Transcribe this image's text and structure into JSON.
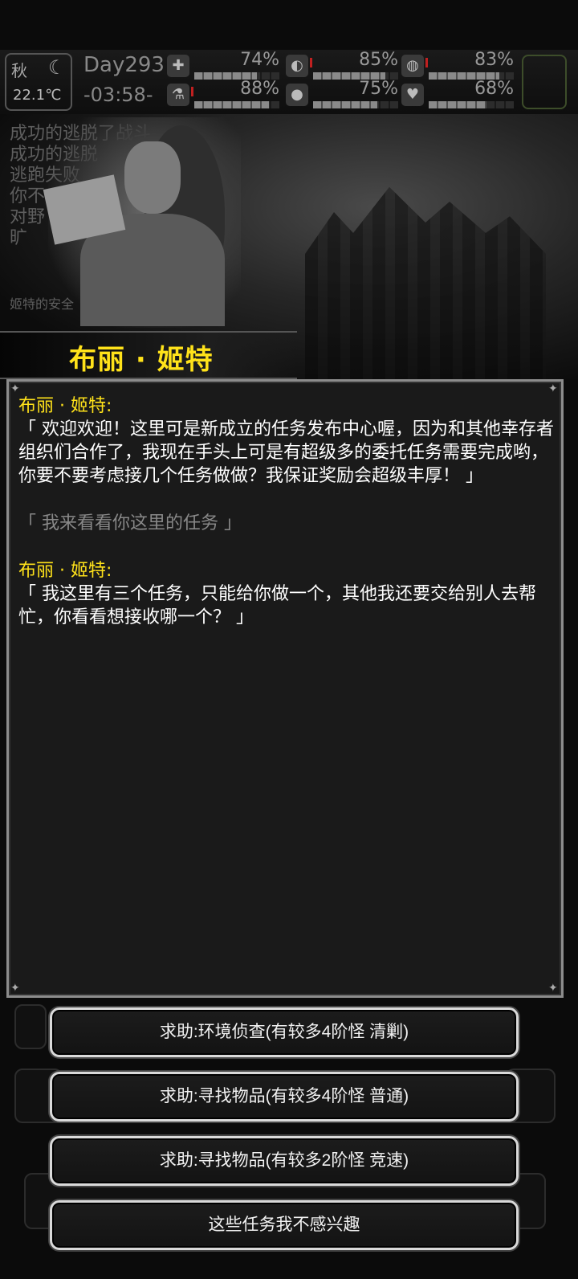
{
  "status": {
    "season": "秋",
    "temperature": "22.1℃",
    "day": "Day293",
    "time": "-03:58-",
    "stats": [
      {
        "icon": "first-aid-icon",
        "glyph": "✚",
        "value": "74%",
        "level": 0.74
      },
      {
        "icon": "stomach-icon",
        "glyph": "◐",
        "value": "85%",
        "level": 0.85
      },
      {
        "icon": "pill-icon",
        "glyph": "◍",
        "value": "83%",
        "level": 0.83
      },
      {
        "icon": "flask-icon",
        "glyph": "⚗",
        "value": "88%",
        "level": 0.88
      },
      {
        "icon": "water-drop-icon",
        "glyph": "💧",
        "value": "75%",
        "level": 0.75
      },
      {
        "icon": "heart-icon",
        "glyph": "♥",
        "value": "68%",
        "level": 0.68
      }
    ]
  },
  "background_log": [
    "成功的逃脱了战斗",
    "成功的逃脱",
    "逃跑失败",
    "你不",
    "对野",
    "旷",
    "姬特的安全"
  ],
  "speaker_name": "布丽 · 姬特",
  "dialog": {
    "speaker_label": "布丽 · 姬特:",
    "line1": "「 欢迎欢迎！这里可是新成立的任务发布中心喔，因为和其他幸存者组织们合作了，我现在手头上可是有超级多的委托任务需要完成哟，你要不要考虑接几个任务做做？我保证奖励会超级丰厚！ 」",
    "player_line": "「 我来看看你这里的任务 」",
    "line2": "「 我这里有三个任务，只能给你做一个，其他我还要交给别人去帮忙，你看看想接收哪一个？ 」"
  },
  "choices": [
    "求助:环境侦查(有较多4阶怪  清剿)",
    "求助:寻找物品(有较多4阶怪  普通)",
    "求助:寻找物品(有较多2阶怪  竞速)",
    "这些任务我不感兴趣"
  ]
}
